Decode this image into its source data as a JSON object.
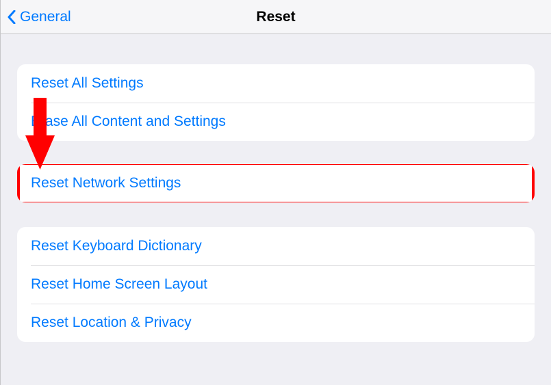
{
  "navbar": {
    "back_label": "General",
    "title": "Reset"
  },
  "groups": {
    "g1": {
      "row0": "Reset All Settings",
      "row1": "Erase All Content and Settings"
    },
    "g2": {
      "row0": "Reset Network Settings"
    },
    "g3": {
      "row0": "Reset Keyboard Dictionary",
      "row1": "Reset Home Screen Layout",
      "row2": "Reset Location & Privacy"
    }
  },
  "annotation": {
    "highlight_color": "#ff0000",
    "arrow_target": "reset-network-settings"
  }
}
